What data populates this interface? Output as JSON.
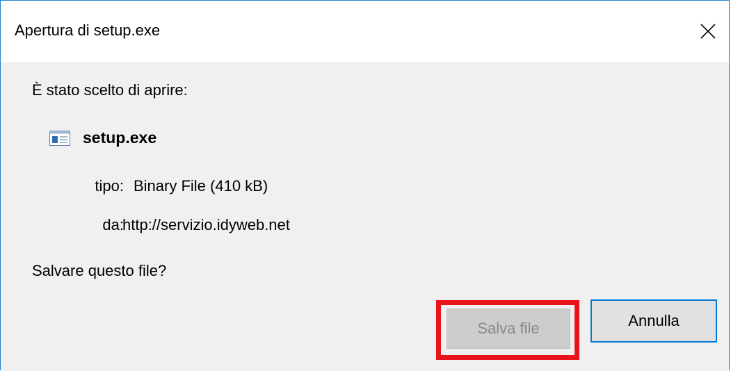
{
  "dialog": {
    "title": "Apertura di setup.exe",
    "close_icon": "close-icon"
  },
  "content": {
    "intro": "È stato scelto di aprire:",
    "file_icon": "file-icon",
    "file_name": "setup.exe",
    "type_label": "tipo:",
    "type_value": "Binary File (410 kB)",
    "from_label": "da:",
    "from_value": "http://servizio.idyweb.net",
    "question": "Salvare questo file?"
  },
  "buttons": {
    "save_label": "Salva file",
    "cancel_label": "Annulla"
  },
  "colors": {
    "highlight": "#e8141c",
    "focus_border": "#0078d7",
    "window_border": "#1f7fd0"
  }
}
